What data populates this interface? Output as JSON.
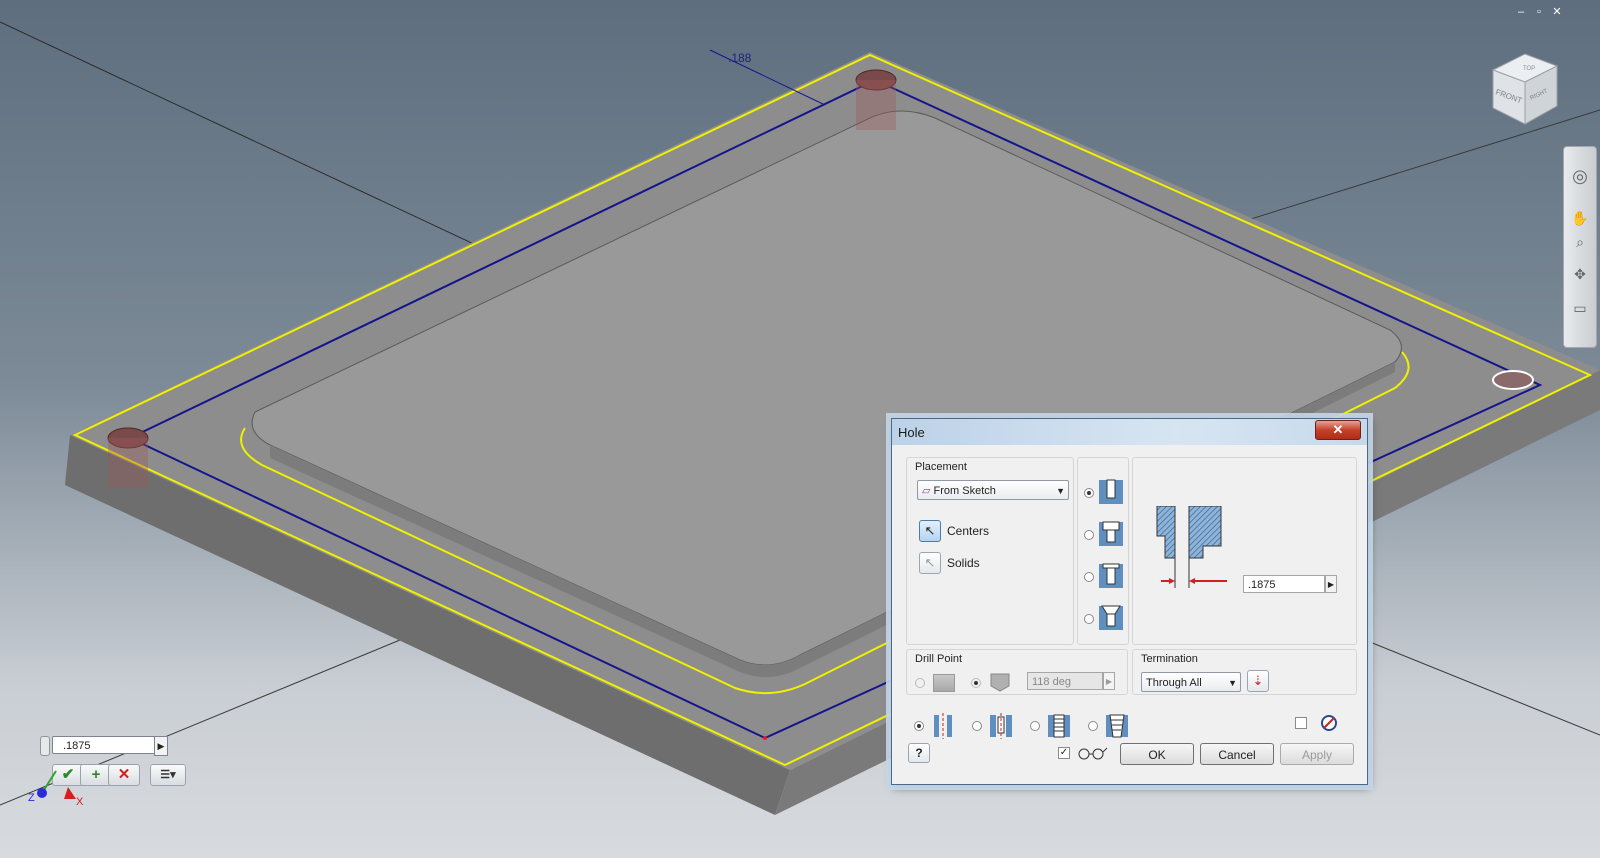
{
  "window": {
    "minimize": "–",
    "restore": "▫",
    "close": "✕"
  },
  "viewcube": {
    "top": "TOP",
    "front": "FRONT",
    "right": "RIGHT"
  },
  "model": {
    "dimension_label": ".188"
  },
  "mini_toolbar": {
    "value": ".1875",
    "ok_glyph": "✔",
    "plus_glyph": "+",
    "cancel_glyph": "✕",
    "options_glyph": "☰▾"
  },
  "triad": {
    "z": "Z",
    "x": "X"
  },
  "dialog": {
    "title": "Hole",
    "close_glyph": "✕",
    "placement": {
      "label": "Placement",
      "type_value": "From Sketch",
      "centers_label": "Centers",
      "solids_label": "Solids"
    },
    "hole_types": [
      "drilled",
      "counterbore",
      "spotface",
      "countersink"
    ],
    "preview": {
      "diameter_value": ".1875"
    },
    "drill_point": {
      "label": "Drill Point",
      "angle_value": "118 deg"
    },
    "termination": {
      "label": "Termination",
      "value": "Through All"
    },
    "thread_types": [
      "simple-hole",
      "clearance-hole",
      "tapped-hole",
      "taper-tapped-hole"
    ],
    "buttons": {
      "ok": "OK",
      "cancel": "Cancel",
      "apply": "Apply",
      "help": "?"
    }
  },
  "colors": {
    "edge_highlight": "#f0f000",
    "sketch_line": "#14148c",
    "face": "#8f8f8f",
    "dialog_bg": "#f0f0f0"
  }
}
